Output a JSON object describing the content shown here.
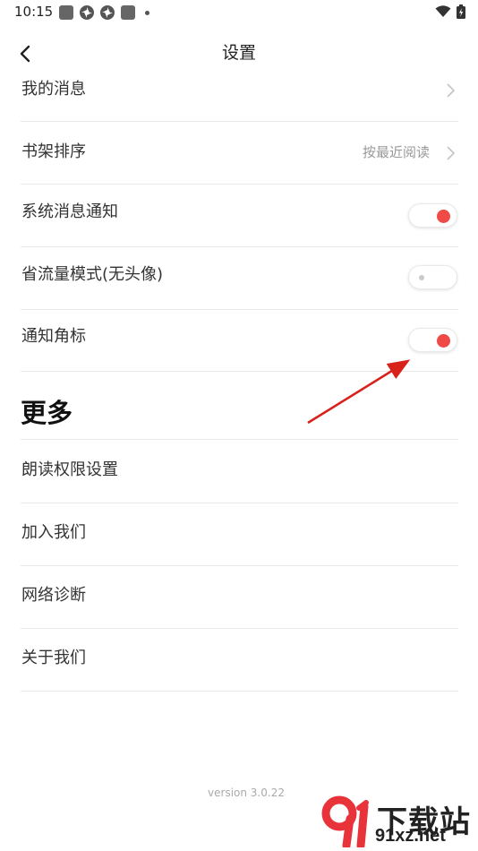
{
  "status_bar": {
    "time": "10:15",
    "left_icons": [
      "square-notification-icon",
      "pinwheel-app-icon",
      "pinwheel-app-icon",
      "square-notification-icon",
      "more-dot-icon"
    ],
    "right_icons": [
      "wifi-icon",
      "battery-charging-icon"
    ]
  },
  "header": {
    "title": "设置",
    "back_icon": "chevron-left-icon"
  },
  "settings": {
    "my_messages": {
      "label": "我的消息"
    },
    "shelf_sort": {
      "label": "书架排序",
      "value": "按最近阅读"
    },
    "system_notify": {
      "label": "系统消息通知",
      "on": true
    },
    "data_saver": {
      "label": "省流量模式(无头像)",
      "on": false
    },
    "badge": {
      "label": "通知角标",
      "on": true
    }
  },
  "more": {
    "title": "更多",
    "items": [
      {
        "label": "朗读权限设置"
      },
      {
        "label": "加入我们"
      },
      {
        "label": "网络诊断"
      },
      {
        "label": "关于我们"
      }
    ]
  },
  "footer": {
    "version": "version 3.0.22"
  },
  "watermark": {
    "text": "下载站",
    "url": "91xz.net"
  },
  "colors": {
    "accent": "#ef4a45",
    "divider": "#e9e9e9",
    "annotation_arrow": "#d9211b",
    "watermark_logo": "#e8333b"
  }
}
